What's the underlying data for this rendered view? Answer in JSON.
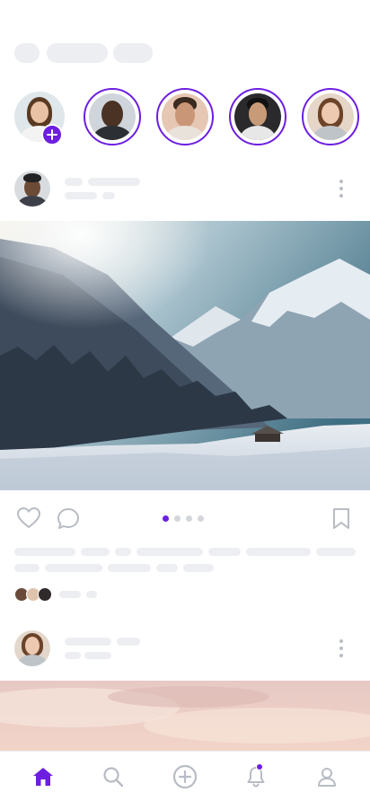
{
  "feed": {
    "story_count": 5,
    "posts": [
      {
        "image": "snowy-mountain-valley",
        "carousel": {
          "pages": 4,
          "active": 1
        }
      },
      {
        "image": "pink-sky-clouds"
      }
    ]
  },
  "icons": {
    "like": "heart-icon",
    "comment": "comment-icon",
    "save": "bookmark-icon",
    "more": "more-vertical-icon",
    "add_story": "plus-icon",
    "nav": [
      "home-icon",
      "search-icon",
      "add-circle-icon",
      "bell-icon",
      "profile-icon"
    ]
  },
  "colors": {
    "accent": "#6d1fe0",
    "skeleton": "#eceef1",
    "icon": "#b8bcc4"
  },
  "bottom_nav": {
    "active": "home",
    "notifications_unread": true
  }
}
